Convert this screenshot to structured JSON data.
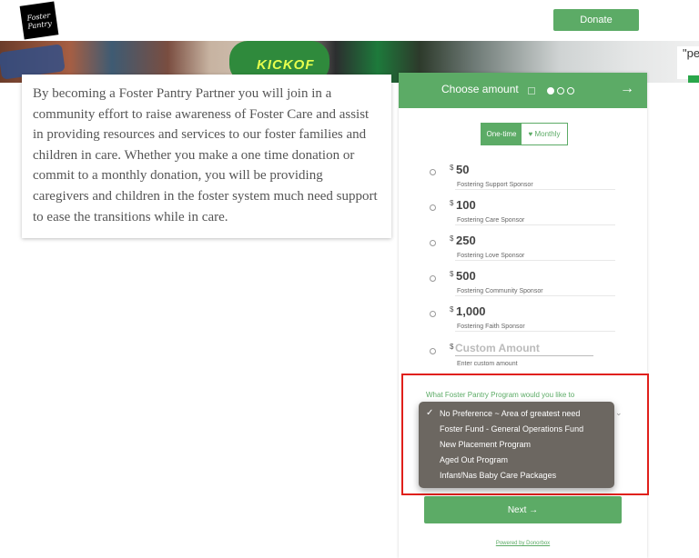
{
  "header": {
    "logo_text": "Foster Pantry",
    "donate_label": "Donate"
  },
  "hero": {
    "kick_text": "KICKOF",
    "sign_text": "\"pe pa"
  },
  "intro": {
    "text": "By becoming a Foster Pantry Partner you will join in a community effort to raise awareness of Foster Care and assist in providing resources and services to our foster families and children in care. Whether you make a one time donation or commit to a monthly donation, you will be providing caregivers and children in the foster system much need support to ease the transitions while in care."
  },
  "form": {
    "title": "Choose amount",
    "next_icon": "arrow-right-icon",
    "frequency": {
      "one_time": "One-time",
      "monthly": "♥ Monthly"
    },
    "currency": "$",
    "amounts": [
      {
        "amount": "50",
        "desc": "Fostering Support Sponsor"
      },
      {
        "amount": "100",
        "desc": "Fostering Care Sponsor"
      },
      {
        "amount": "250",
        "desc": "Fostering Love Sponsor"
      },
      {
        "amount": "500",
        "desc": "Fostering Community Sponsor"
      },
      {
        "amount": "1,000",
        "desc": "Fostering Faith Sponsor"
      }
    ],
    "custom": {
      "placeholder": "Custom Amount",
      "desc": "Enter custom amount"
    },
    "program_label": "What Foster Pantry Program would you like to",
    "program_options": [
      {
        "label": "No Preference ~ Area of greatest need",
        "selected": true
      },
      {
        "label": "Foster Fund - General Operations Fund",
        "selected": false
      },
      {
        "label": "New Placement Program",
        "selected": false
      },
      {
        "label": "Aged Out Program",
        "selected": false
      },
      {
        "label": "Infant/Nas Baby Care Packages",
        "selected": false
      }
    ],
    "next_label": "Next →",
    "powered_by": "Powered by Donorbox"
  },
  "colors": {
    "accent": "#5cab66",
    "highlight": "#e0201b",
    "dropdown_bg": "#6c6761"
  }
}
